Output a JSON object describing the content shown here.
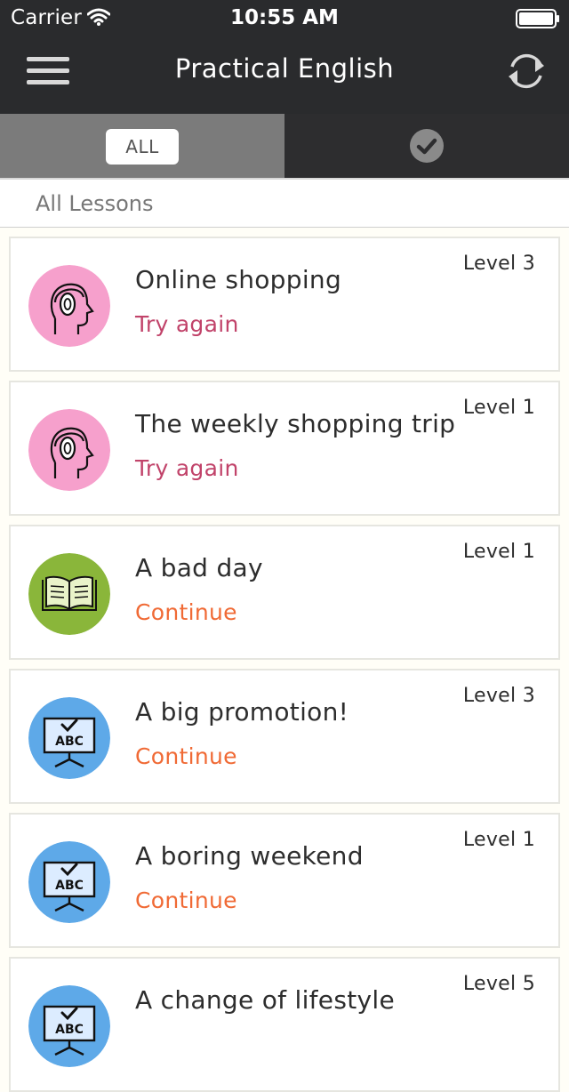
{
  "status_bar": {
    "carrier": "Carrier",
    "time": "10:55 AM"
  },
  "header": {
    "title": "Practical English",
    "menu_icon": "hamburger-menu-icon",
    "sync_icon": "sync-icon"
  },
  "tabs": {
    "all_label": "ALL",
    "completed_icon": "check-circle-icon"
  },
  "section": {
    "title": "All Lessons"
  },
  "colors": {
    "header_bg": "#2a2b2d",
    "try_again": "#c1436a",
    "continue": "#f06a35",
    "listening_icon_bg": "#f6a0cc",
    "reading_icon_bg": "#8ab63a",
    "grammar_icon_bg": "#5ea9e8"
  },
  "lessons": [
    {
      "title": "Online shopping",
      "status": "Try again",
      "level": "Level 3",
      "icon": "headphones-head-icon"
    },
    {
      "title": "The weekly shopping trip",
      "status": "Try again",
      "level": "Level 1",
      "icon": "headphones-head-icon"
    },
    {
      "title": "A bad day",
      "status": "Continue",
      "level": "Level 1",
      "icon": "open-book-icon"
    },
    {
      "title": "A big promotion!",
      "status": "Continue",
      "level": "Level 3",
      "icon": "abc-board-icon"
    },
    {
      "title": "A boring weekend",
      "status": "Continue",
      "level": "Level 1",
      "icon": "abc-board-icon"
    },
    {
      "title": "A change of lifestyle",
      "status": "",
      "level": "Level 5",
      "icon": "abc-board-icon"
    }
  ]
}
